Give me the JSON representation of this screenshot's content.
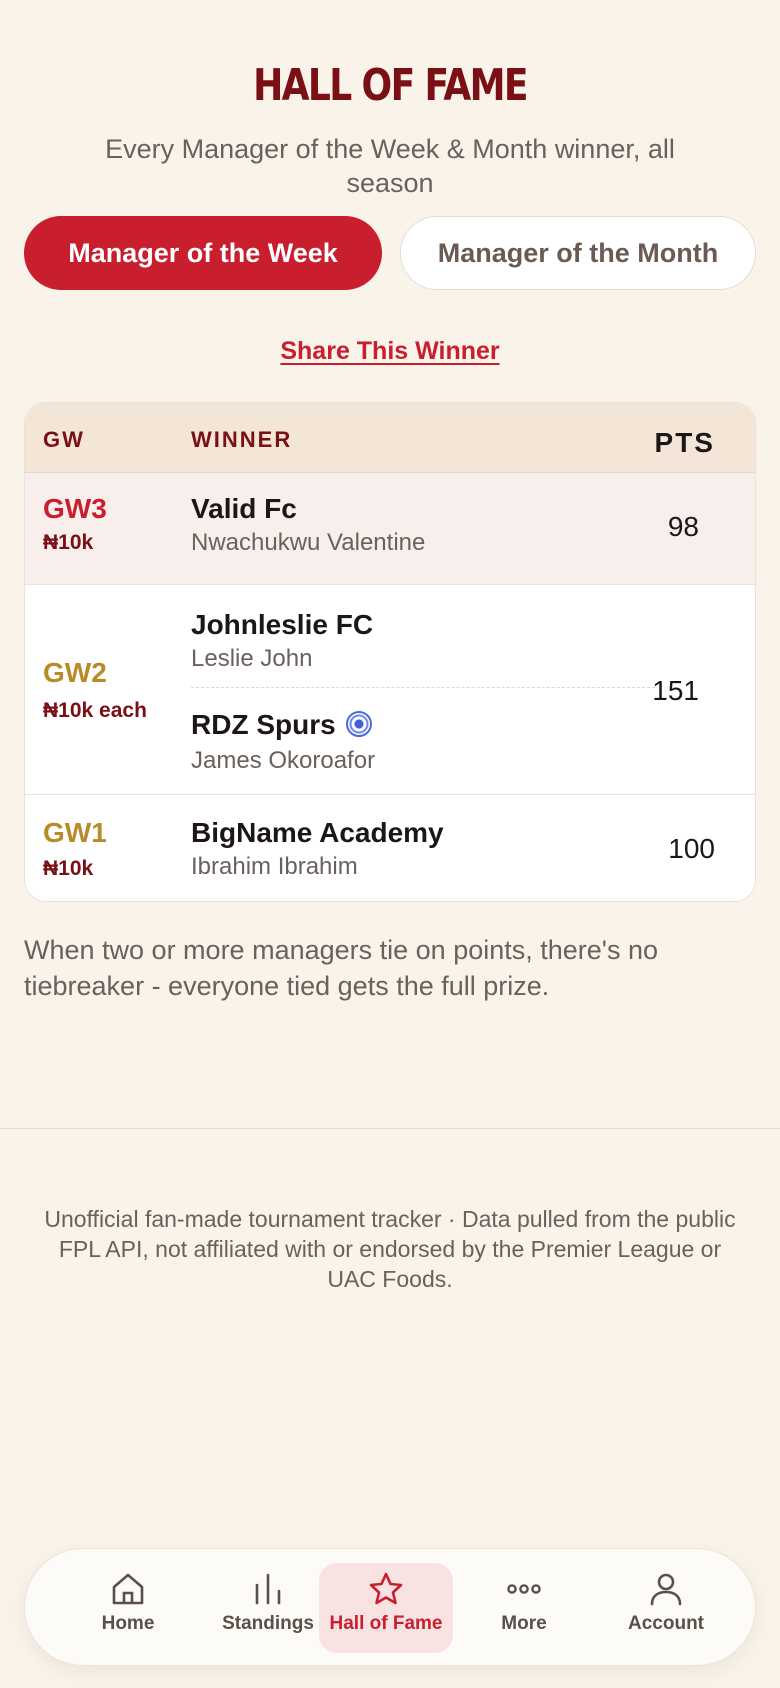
{
  "header": {
    "title": "HALL OF FAME",
    "subtitle": "Every Manager of the Week & Month winner, all season"
  },
  "tabs": [
    {
      "label": "Manager of the Week",
      "active": true
    },
    {
      "label": "Manager of the Month",
      "active": false
    }
  ],
  "share_label": "Share This Winner",
  "table": {
    "headers": {
      "gw": "GW",
      "winner": "WINNER",
      "pts": "PTS"
    },
    "rows": [
      {
        "gw": "GW3",
        "prize": "₦10k",
        "winners": [
          {
            "team": "Valid Fc",
            "manager": "Nwachukwu Valentine"
          }
        ],
        "pts": "98"
      },
      {
        "gw": "GW2",
        "prize": "₦10k each",
        "winners": [
          {
            "team": "Johnleslie FC",
            "manager": "Leslie John"
          },
          {
            "team": "RDZ Spurs",
            "manager": "James Okoroafor",
            "icon": "soccer-ball-icon"
          }
        ],
        "pts": "151"
      },
      {
        "gw": "GW1",
        "prize": "₦10k",
        "winners": [
          {
            "team": "BigName Academy",
            "manager": "Ibrahim Ibrahim"
          }
        ],
        "pts": "100"
      }
    ]
  },
  "note": "When two or more managers tie on points, there's no tiebreaker - everyone tied gets the full prize.",
  "footer": "Unofficial fan-made tournament tracker · Data pulled from the public FPL API, not affiliated with or endorsed by the Premier League or UAC Foods.",
  "nav": [
    {
      "label": "Home",
      "icon": "home-icon",
      "active": false
    },
    {
      "label": "Standings",
      "icon": "standings-icon",
      "active": false
    },
    {
      "label": "Hall of Fame",
      "icon": "star-icon",
      "active": true
    },
    {
      "label": "More",
      "icon": "more-icon",
      "active": false
    },
    {
      "label": "Account",
      "icon": "account-icon",
      "active": false
    }
  ],
  "colors": {
    "accent": "#c81e2e",
    "title": "#7a0f15",
    "gold": "#b98a2a",
    "background": "#f9f3ea"
  }
}
